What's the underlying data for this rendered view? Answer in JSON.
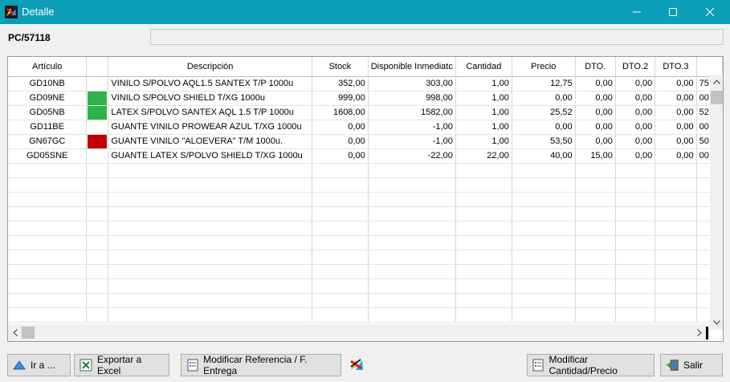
{
  "window": {
    "title": "Detalle"
  },
  "header": {
    "code": "PC/57118",
    "field_value": ""
  },
  "grid": {
    "columns": [
      "Artículo",
      "",
      "Descripción",
      "Stock",
      "Disponible Inmediatc",
      "Cantidad",
      "Precio",
      "DTO.",
      "DTO.2",
      "DTO.3",
      ""
    ],
    "rows": [
      {
        "articulo": "GD10NB",
        "color": "",
        "descripcion": "VINILO S/POLVO AQL1.5 SANTEX T/P 1000u",
        "stock": "352,00",
        "disponible": "303,00",
        "cantidad": "1,00",
        "precio": "12,75",
        "dto": "0,00",
        "dto2": "0,00",
        "dto3": "0,00",
        "extra": "75"
      },
      {
        "articulo": "GD09NE",
        "color": "#2db34a",
        "descripcion": "VINILO S/POLVO SHIELD T/XG 1000u",
        "stock": "999,00",
        "disponible": "998,00",
        "cantidad": "1,00",
        "precio": "0,00",
        "dto": "0,00",
        "dto2": "0,00",
        "dto3": "0,00",
        "extra": "00"
      },
      {
        "articulo": "GD05NB",
        "color": "#2db34a",
        "descripcion": "LATEX S/POLVO SANTEX AQL 1.5 T/P 1000u",
        "stock": "1608,00",
        "disponible": "1582,00",
        "cantidad": "1,00",
        "precio": "25,52",
        "dto": "0,00",
        "dto2": "0,00",
        "dto3": "0,00",
        "extra": "52"
      },
      {
        "articulo": "GD11BE",
        "color": "",
        "descripcion": "GUANTE VINILO PROWEAR AZUL T/XG 1000u",
        "stock": "0,00",
        "disponible": "-1,00",
        "cantidad": "1,00",
        "precio": "0,00",
        "dto": "0,00",
        "dto2": "0,00",
        "dto3": "0,00",
        "extra": "00"
      },
      {
        "articulo": "GN67GC",
        "color": "#c00000",
        "descripcion": "GUANTE VINILO \"ALOEVERA\" T/M 1000u.",
        "stock": "0,00",
        "disponible": "-1,00",
        "cantidad": "1,00",
        "precio": "53,50",
        "dto": "0,00",
        "dto2": "0,00",
        "dto3": "0,00",
        "extra": "50"
      },
      {
        "articulo": "GD05SNE",
        "color": "",
        "descripcion": "GUANTE LATEX S/POLVO SHIELD T/XG 1000u",
        "stock": "0,00",
        "disponible": "-22,00",
        "cantidad": "22,00",
        "precio": "40,00",
        "dto": "15,00",
        "dto2": "0,00",
        "dto3": "0,00",
        "extra": "00"
      }
    ],
    "empty_rows": 11
  },
  "buttons": {
    "ir_a": "Ir a ...",
    "exportar": "Exportar a Excel",
    "modificar_ref": "Modificar Referencia / F. Entrega",
    "modificar_cant": "Modificar Cantidad/Precio",
    "salir": "Salir"
  },
  "icons": {
    "app": "app-logo-icon",
    "ir_a": "triangle-up-icon",
    "exportar": "excel-icon",
    "modificar": "document-list-icon",
    "salir": "exit-door-icon",
    "logo": "company-logo-icon"
  },
  "colors": {
    "titlebar": "#0b9fb7",
    "green": "#2db34a",
    "red": "#c00000"
  }
}
